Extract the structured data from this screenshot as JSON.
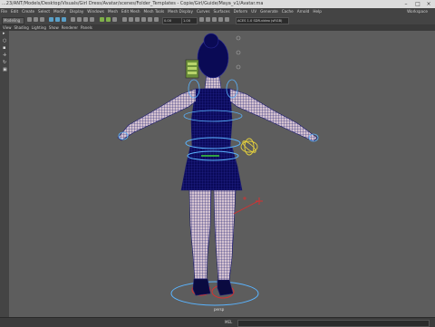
{
  "window": {
    "title": "...23/ANT/Models/Desktop/Visuals/Girl Dress/Avatar/scenes/Folder_Templates - Copie/Girl/Guide/Maya_v1/Avatar.ma",
    "minimize": "–",
    "maximize": "□",
    "close": "×"
  },
  "menubar": {
    "items": [
      "File",
      "Edit",
      "Create",
      "Select",
      "Modify",
      "Display",
      "Windows",
      "Mesh",
      "Edit Mesh",
      "Mesh Tools",
      "Mesh Display",
      "Curves",
      "Surfaces",
      "Deform",
      "UV",
      "Generate",
      "Cache",
      "Arnold",
      "Help"
    ],
    "workspace": "Workspace"
  },
  "statusline": {
    "mode": "Modeling",
    "field_near": "0.00",
    "field_far": "1.00",
    "color_space": "ACES 1.0 SDR-video (sRGB)"
  },
  "panel_menu": {
    "items": [
      "View",
      "Shading",
      "Lighting",
      "Show",
      "Renderer",
      "Panels"
    ]
  },
  "viewport": {
    "camera_label": "persp",
    "background_color": "#5d5d5d",
    "wire_color": "#1a1a6e",
    "control_color": "#5ab4ff",
    "handle_color": "#d83030"
  },
  "command_line": {
    "language": "MEL"
  }
}
